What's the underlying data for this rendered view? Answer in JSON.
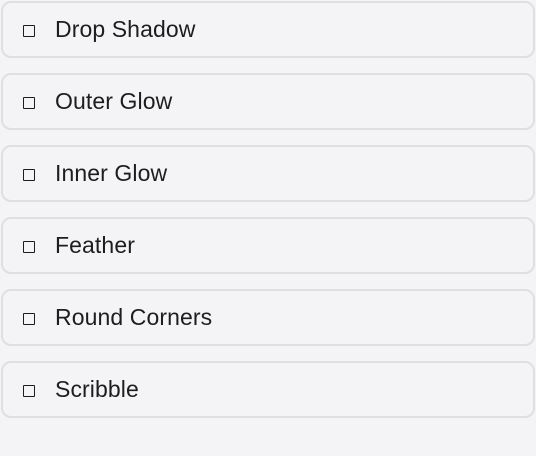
{
  "effects": {
    "items": [
      {
        "label": "Drop Shadow",
        "checked": false
      },
      {
        "label": "Outer Glow",
        "checked": false
      },
      {
        "label": "Inner Glow",
        "checked": false
      },
      {
        "label": "Feather",
        "checked": false
      },
      {
        "label": "Round Corners",
        "checked": false
      },
      {
        "label": "Scribble",
        "checked": false
      }
    ]
  },
  "colors": {
    "background": "#f4f4f6",
    "item_border": "#dedfe2",
    "text": "#1d1d1f"
  }
}
